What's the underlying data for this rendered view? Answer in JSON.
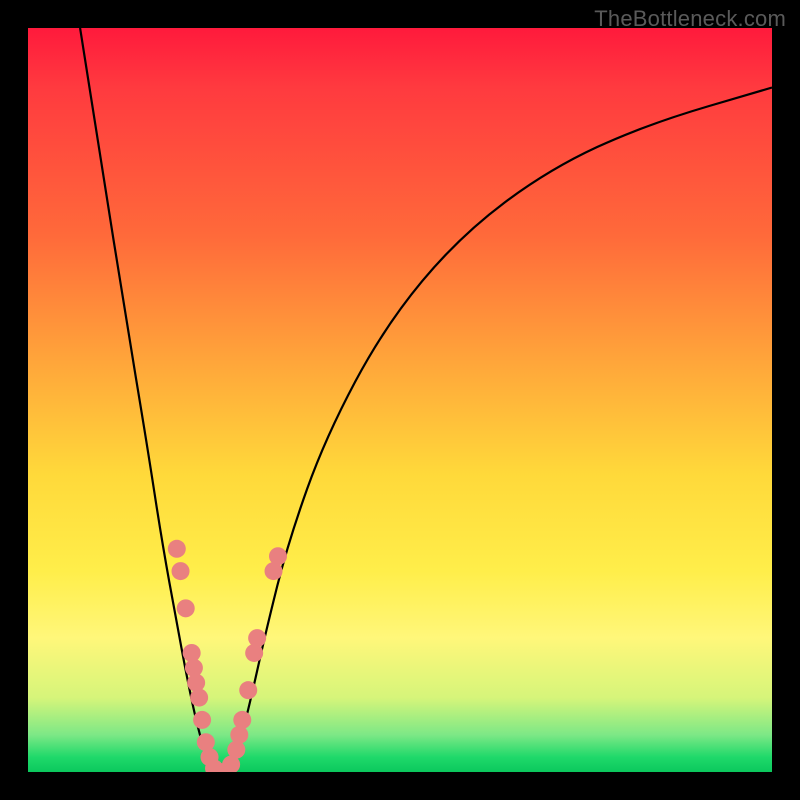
{
  "watermark": {
    "text": "TheBottleneck.com"
  },
  "chart_data": {
    "type": "line",
    "title": "",
    "xlabel": "",
    "ylabel": "",
    "xlim": [
      0,
      100
    ],
    "ylim": [
      0,
      100
    ],
    "background_gradient": [
      "#ff1a3c",
      "#ff6a3a",
      "#ffd93a",
      "#fff77a",
      "#1fd96a"
    ],
    "series": [
      {
        "name": "left-arm",
        "color": "#000000",
        "x": [
          7,
          10,
          13,
          16,
          18,
          20,
          21.5,
          22.8,
          24,
          25
        ],
        "values": [
          100,
          81,
          62,
          44,
          31,
          20,
          12,
          6,
          2,
          0
        ]
      },
      {
        "name": "right-arm",
        "color": "#000000",
        "x": [
          27,
          28.5,
          30,
          32,
          35,
          40,
          48,
          58,
          70,
          83,
          100
        ],
        "values": [
          0,
          4,
          10,
          19,
          31,
          45,
          60,
          72,
          81,
          87,
          92
        ]
      }
    ],
    "markers": [
      {
        "series": "left-arm",
        "x": 20.0,
        "y": 30.0
      },
      {
        "series": "left-arm",
        "x": 20.5,
        "y": 27.0
      },
      {
        "series": "left-arm",
        "x": 21.2,
        "y": 22.0
      },
      {
        "series": "left-arm",
        "x": 22.0,
        "y": 16.0
      },
      {
        "series": "left-arm",
        "x": 22.3,
        "y": 14.0
      },
      {
        "series": "left-arm",
        "x": 22.6,
        "y": 12.0
      },
      {
        "series": "left-arm",
        "x": 23.0,
        "y": 10.0
      },
      {
        "series": "left-arm",
        "x": 23.4,
        "y": 7.0
      },
      {
        "series": "left-arm",
        "x": 23.9,
        "y": 4.0
      },
      {
        "series": "left-arm",
        "x": 24.4,
        "y": 2.0
      },
      {
        "series": "left-arm",
        "x": 25.0,
        "y": 0.5
      },
      {
        "series": "left-arm",
        "x": 25.8,
        "y": 0.0
      },
      {
        "series": "left-arm",
        "x": 26.6,
        "y": 0.0
      },
      {
        "series": "right-arm",
        "x": 27.3,
        "y": 1.0
      },
      {
        "series": "right-arm",
        "x": 28.0,
        "y": 3.0
      },
      {
        "series": "right-arm",
        "x": 28.4,
        "y": 5.0
      },
      {
        "series": "right-arm",
        "x": 28.8,
        "y": 7.0
      },
      {
        "series": "right-arm",
        "x": 29.6,
        "y": 11.0
      },
      {
        "series": "right-arm",
        "x": 30.4,
        "y": 16.0
      },
      {
        "series": "right-arm",
        "x": 30.8,
        "y": 18.0
      },
      {
        "series": "right-arm",
        "x": 33.0,
        "y": 27.0
      },
      {
        "series": "right-arm",
        "x": 33.6,
        "y": 29.0
      }
    ],
    "marker_style": {
      "color": "#e98080",
      "radius": 9
    }
  }
}
